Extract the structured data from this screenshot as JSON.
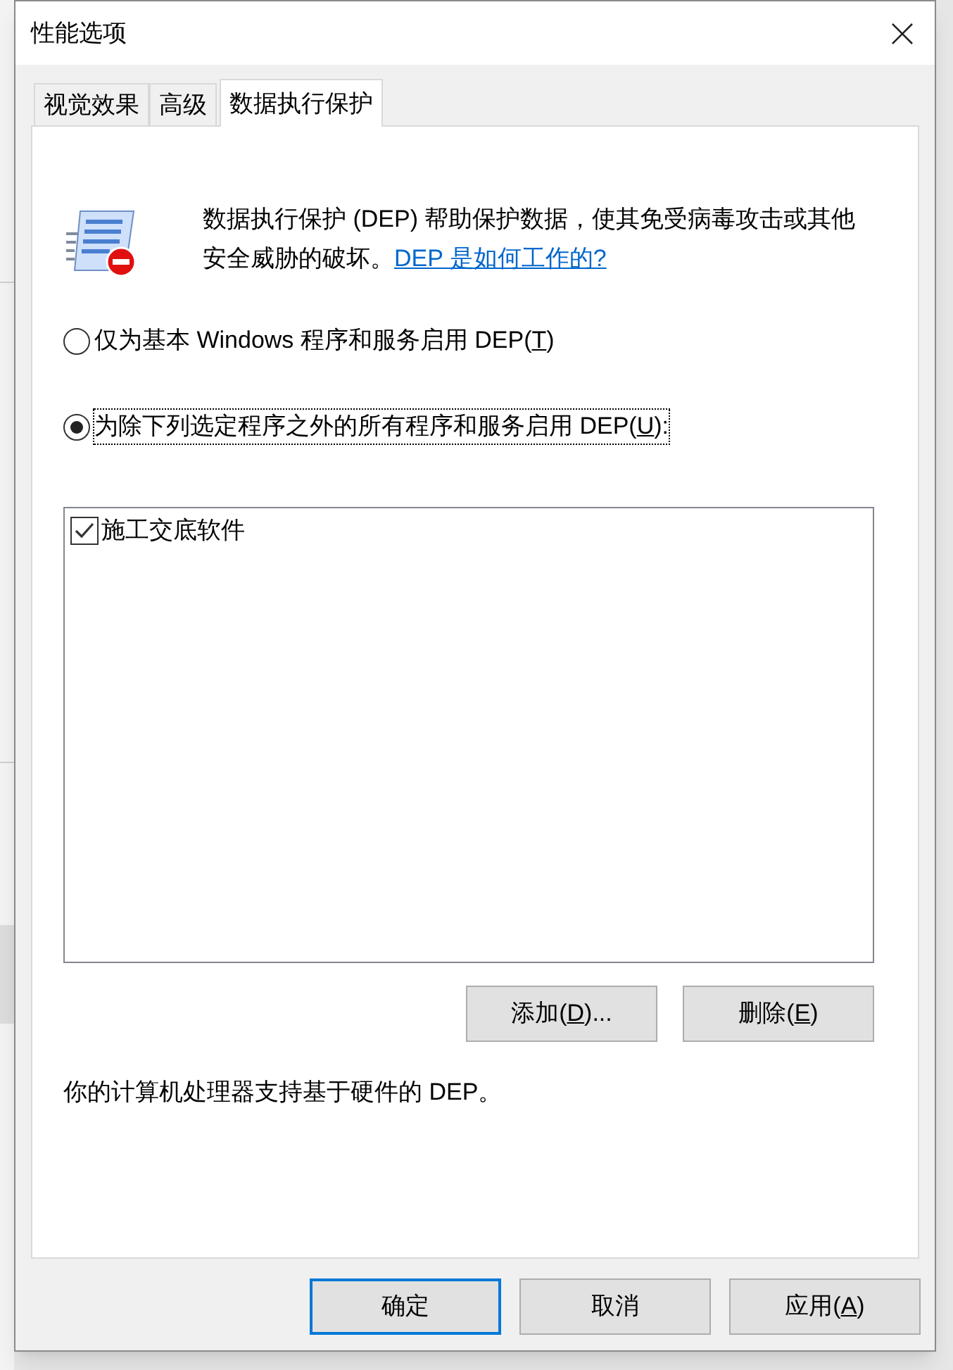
{
  "window": {
    "title": "性能选项"
  },
  "tabs": [
    {
      "label": "视觉效果",
      "selected": false
    },
    {
      "label": "高级",
      "selected": false
    },
    {
      "label": "数据执行保护",
      "selected": true
    }
  ],
  "description": {
    "text": "数据执行保护 (DEP) 帮助保护数据，使其免受病毒攻击或其他安全威胁的破坏。",
    "link": "DEP 是如何工作的?"
  },
  "options": [
    {
      "before": "仅为基本 Windows 程序和服务启用 DEP(",
      "key": "T",
      "after": ")",
      "selected": false,
      "focused": false
    },
    {
      "before": "为除下列选定程序之外的所有程序和服务启用 DEP(",
      "key": "U",
      "after": "):",
      "selected": true,
      "focused": true
    }
  ],
  "programs": [
    {
      "name": "施工交底软件",
      "checked": true
    }
  ],
  "list_buttons": [
    {
      "before": "添加(",
      "key": "D",
      "after": ")..."
    },
    {
      "before": "删除(",
      "key": "E",
      "after": ")"
    }
  ],
  "status": "你的计算机处理器支持基于硬件的 DEP。",
  "buttons": [
    {
      "label": "确定",
      "default": true
    },
    {
      "label": "取消",
      "default": false
    },
    {
      "before": "应用(",
      "key": "A",
      "after": ")",
      "default": false
    }
  ]
}
